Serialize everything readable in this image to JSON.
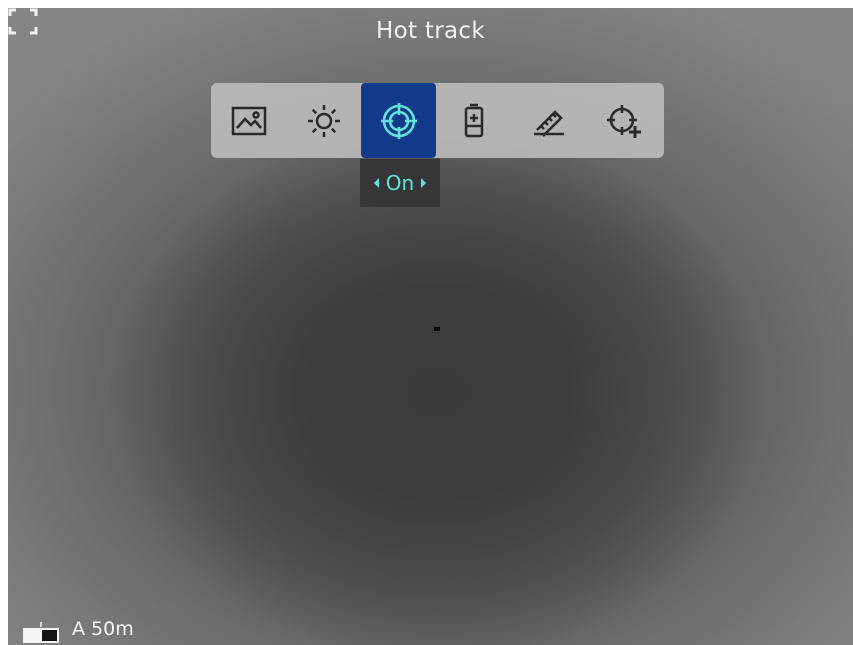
{
  "header": {
    "title": "Hot track"
  },
  "toolbar": {
    "items": [
      {
        "icon": "image-mode-icon",
        "active": false
      },
      {
        "icon": "brightness-icon",
        "active": false
      },
      {
        "icon": "hot-track-icon",
        "active": true
      },
      {
        "icon": "battery-plus-icon",
        "active": false
      },
      {
        "icon": "ruler-icon",
        "active": false
      },
      {
        "icon": "crosshair-add-icon",
        "active": false
      }
    ],
    "active_color": "#123a8a",
    "active_icon_color": "#5fe3dc"
  },
  "popup": {
    "value": "On"
  },
  "status": {
    "range_text": "A 50m"
  }
}
